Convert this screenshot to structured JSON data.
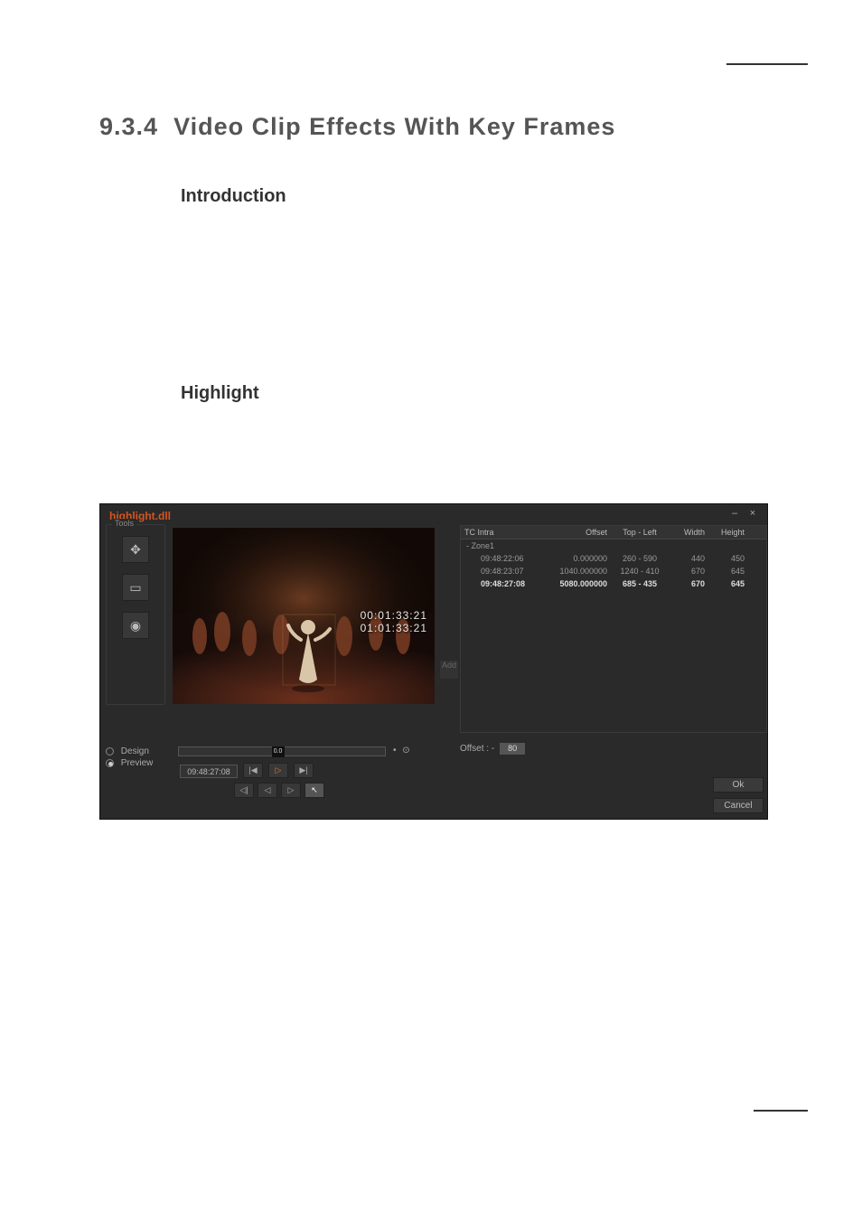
{
  "doc": {
    "section_number": "9.3.4",
    "section_title": "Video Clip Effects With Key Frames",
    "sub_intro": "Introduction",
    "sub_highlight": "Highlight"
  },
  "dialog": {
    "title": "highlight.dll",
    "minimize": "–",
    "close": "×",
    "tools_label": "Tools",
    "tool_move_icon": "✥",
    "tool_rect_icon": "▭",
    "tool_focus_icon": "◉",
    "add_label": "Add",
    "tc_overlay_1": "00:01:33:21",
    "tc_overlay_2": "01:01:33:21",
    "radio_design": "Design",
    "radio_preview": "Preview",
    "loop_icons": "• ⊙",
    "slider_marker": "0.0",
    "tc_field": "09:48:27:08",
    "btn_first": "|◀",
    "btn_play": "▷",
    "btn_last": "▶|",
    "btn_rew": "◁|",
    "btn_step_back": "◁",
    "btn_step_fwd": "▷",
    "btn_arrow": "↖",
    "table": {
      "headers": {
        "c1": "TC Intra",
        "c2": "Offset",
        "c3": "Top - Left",
        "c4": "Width",
        "c5": "Height"
      },
      "zone_label": "- Zone1",
      "rows": [
        {
          "c1": "09:48:22:06",
          "c2": "0.000000",
          "c3": "260 - 590",
          "c4": "440",
          "c5": "450",
          "bold": false
        },
        {
          "c1": "09:48:23:07",
          "c2": "1040.000000",
          "c3": "1240 - 410",
          "c4": "670",
          "c5": "645",
          "bold": false
        },
        {
          "c1": "09:48:27:08",
          "c2": "5080.000000",
          "c3": "685 - 435",
          "c4": "670",
          "c5": "645",
          "bold": true
        }
      ]
    },
    "offset_label": "Offset : -",
    "offset_value": "80",
    "ok_label": "Ok",
    "cancel_label": "Cancel"
  }
}
